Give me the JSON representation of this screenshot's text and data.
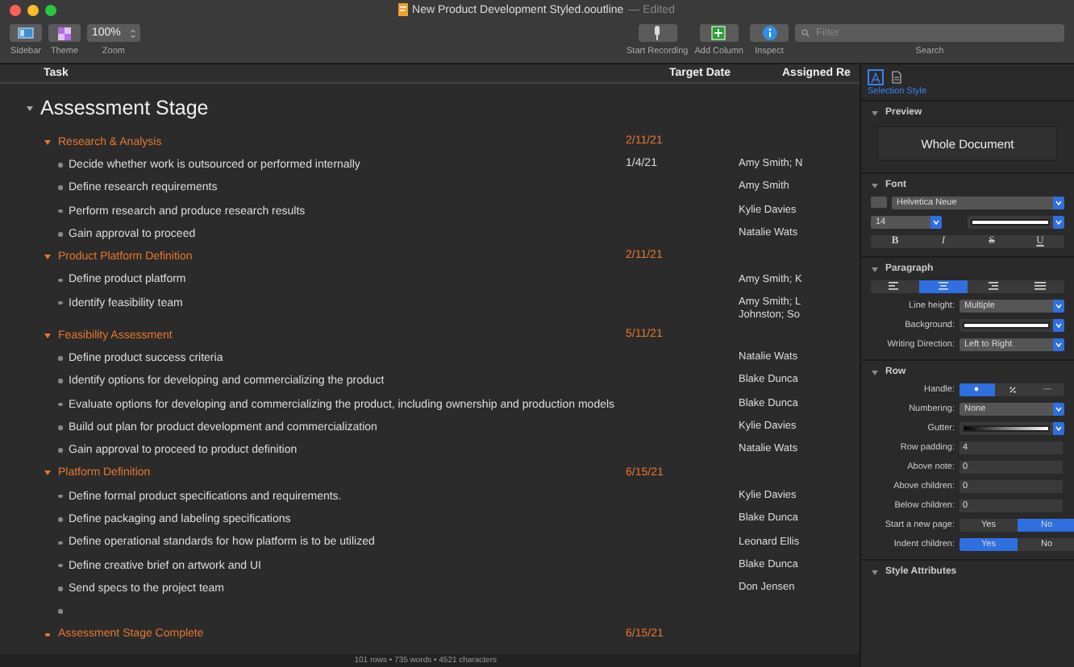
{
  "window": {
    "title": "New Product Development Styled.ooutline",
    "subtitle": "— Edited"
  },
  "toolbar": {
    "left": [
      {
        "kind": "sidebar",
        "label": "Sidebar"
      },
      {
        "kind": "theme",
        "label": "Theme"
      },
      {
        "kind": "zoom",
        "label": "Zoom",
        "value": "100%"
      }
    ],
    "right": [
      {
        "kind": "mic",
        "label": "Start Recording"
      },
      {
        "kind": "column",
        "label": "Add Column"
      },
      {
        "kind": "info",
        "label": "Inspect"
      }
    ],
    "search": {
      "placeholder": "Filter",
      "label": "Search"
    }
  },
  "columns": [
    "Task",
    "Target Date",
    "Assigned Re"
  ],
  "outline": {
    "title": "Assessment Stage",
    "expanded": true,
    "rows": [
      {
        "kind": "group",
        "task": "Research & Analysis",
        "date": "2/11/21",
        "expanded": true,
        "children": [
          {
            "kind": "task",
            "task": "Decide whether work is outsourced or performed internally",
            "date": "1/4/21",
            "assigned": "Amy Smith; N"
          },
          {
            "kind": "task",
            "task": "Define research requirements",
            "assigned": "Amy Smith"
          },
          {
            "kind": "task",
            "task": "Perform research and produce research results",
            "assigned": "Kylie Davies"
          },
          {
            "kind": "task",
            "task": "Gain approval to proceed",
            "assigned": "Natalie Wats"
          }
        ]
      },
      {
        "kind": "group",
        "task": "Product Platform Definition",
        "date": "2/11/21",
        "expanded": true,
        "children": [
          {
            "kind": "task",
            "task": "Define product platform",
            "assigned": "Amy Smith; K"
          },
          {
            "kind": "task",
            "task": "Identify feasibility team",
            "assigned": "Amy Smith; L Johnston; So"
          }
        ]
      },
      {
        "kind": "group",
        "task": "Feasibility Assessment",
        "date": "5/11/21",
        "expanded": true,
        "children": [
          {
            "kind": "task",
            "task": "Define product success criteria",
            "assigned": "Natalie Wats"
          },
          {
            "kind": "task",
            "task": "Identify options for developing and commercializing the product",
            "assigned": "Blake Dunca"
          },
          {
            "kind": "task",
            "task": "Evaluate options for developing and commercializing the product, including ownership and production models",
            "assigned": "Blake Dunca"
          },
          {
            "kind": "task",
            "task": "Build out plan for product development and commercialization",
            "assigned": "Kylie Davies"
          },
          {
            "kind": "task",
            "task": "Gain approval to proceed to product definition",
            "assigned": "Natalie Wats"
          }
        ]
      },
      {
        "kind": "group",
        "task": "Platform Definition",
        "date": "6/15/21",
        "expanded": true,
        "children": [
          {
            "kind": "task",
            "task": "Define formal product specifications and requirements.",
            "assigned": "Kylie Davies"
          },
          {
            "kind": "task",
            "task": "Define packaging and labeling specifications",
            "assigned": "Blake Dunca"
          },
          {
            "kind": "task",
            "task": "Define operational standards for how platform is to be utilized",
            "assigned": "Leonard Ellis"
          },
          {
            "kind": "task",
            "task": "Define creative brief on artwork and UI",
            "assigned": "Blake Dunca"
          },
          {
            "kind": "task",
            "task": "Send specs to the project team",
            "assigned": "Don Jensen"
          },
          {
            "kind": "blank"
          }
        ]
      },
      {
        "kind": "milestone",
        "task": "Assessment Stage Complete",
        "date": "6/15/21"
      }
    ]
  },
  "status_bar": "101 rows • 735 words • 4521 characters",
  "inspector": {
    "tabs": [
      {
        "kind": "text",
        "selected": true
      },
      {
        "kind": "document",
        "selected": false
      }
    ],
    "caption": "Selection Style",
    "sections": [
      {
        "title": "Preview",
        "expanded": true,
        "fields": [
          {
            "kind": "preview",
            "value": "Whole Document"
          }
        ]
      },
      {
        "title": "Font",
        "expanded": true,
        "fields": [
          {
            "kind": "fontname",
            "value": "Helvetica Neue"
          },
          {
            "kind": "sizecolor",
            "value": "14"
          },
          {
            "kind": "styles",
            "options": [
              {
                "kind": "bold",
                "label": "B"
              },
              {
                "kind": "italic",
                "label": "I"
              },
              {
                "kind": "strike",
                "label": "S"
              },
              {
                "kind": "underline",
                "label": "U"
              }
            ]
          }
        ]
      },
      {
        "title": "Paragraph",
        "expanded": true,
        "fields": [
          {
            "kind": "align",
            "options": [
              {
                "kind": "left",
                "selected": false
              },
              {
                "kind": "center",
                "selected": true
              },
              {
                "kind": "right",
                "selected": false
              },
              {
                "kind": "justify",
                "selected": false
              }
            ]
          },
          {
            "kind": "popup",
            "label": "Line height:",
            "value": "Multiple"
          },
          {
            "kind": "swatch",
            "label": "Background:"
          },
          {
            "kind": "popup",
            "label": "Writing Direction:",
            "value": "Left to Right"
          }
        ]
      },
      {
        "title": "Row",
        "expanded": true,
        "fields": [
          {
            "kind": "handle",
            "label": "Handle:",
            "options": [
              {
                "kind": "dot",
                "selected": true
              },
              {
                "kind": "percent",
                "selected": false
              },
              {
                "kind": "none",
                "selected": false
              }
            ]
          },
          {
            "kind": "popup",
            "label": "Numbering:",
            "value": "None"
          },
          {
            "kind": "gradient",
            "label": "Gutter:"
          },
          {
            "kind": "stepper",
            "label": "Row padding:",
            "value": "4"
          },
          {
            "kind": "stepper",
            "label": "Above note:",
            "value": "0"
          },
          {
            "kind": "stepper",
            "label": "Above children:",
            "value": "0"
          },
          {
            "kind": "stepper",
            "label": "Below children:",
            "value": "0"
          },
          {
            "kind": "toggle",
            "label": "Start a new page:",
            "options": [
              {
                "label": "Yes",
                "selected": false
              },
              {
                "label": "No",
                "selected": true
              }
            ]
          },
          {
            "kind": "toggle",
            "label": "Indent children:",
            "options": [
              {
                "label": "Yes",
                "selected": true
              },
              {
                "label": "No",
                "selected": false
              }
            ]
          }
        ]
      },
      {
        "title": "Style Attributes",
        "expanded": true
      }
    ]
  }
}
